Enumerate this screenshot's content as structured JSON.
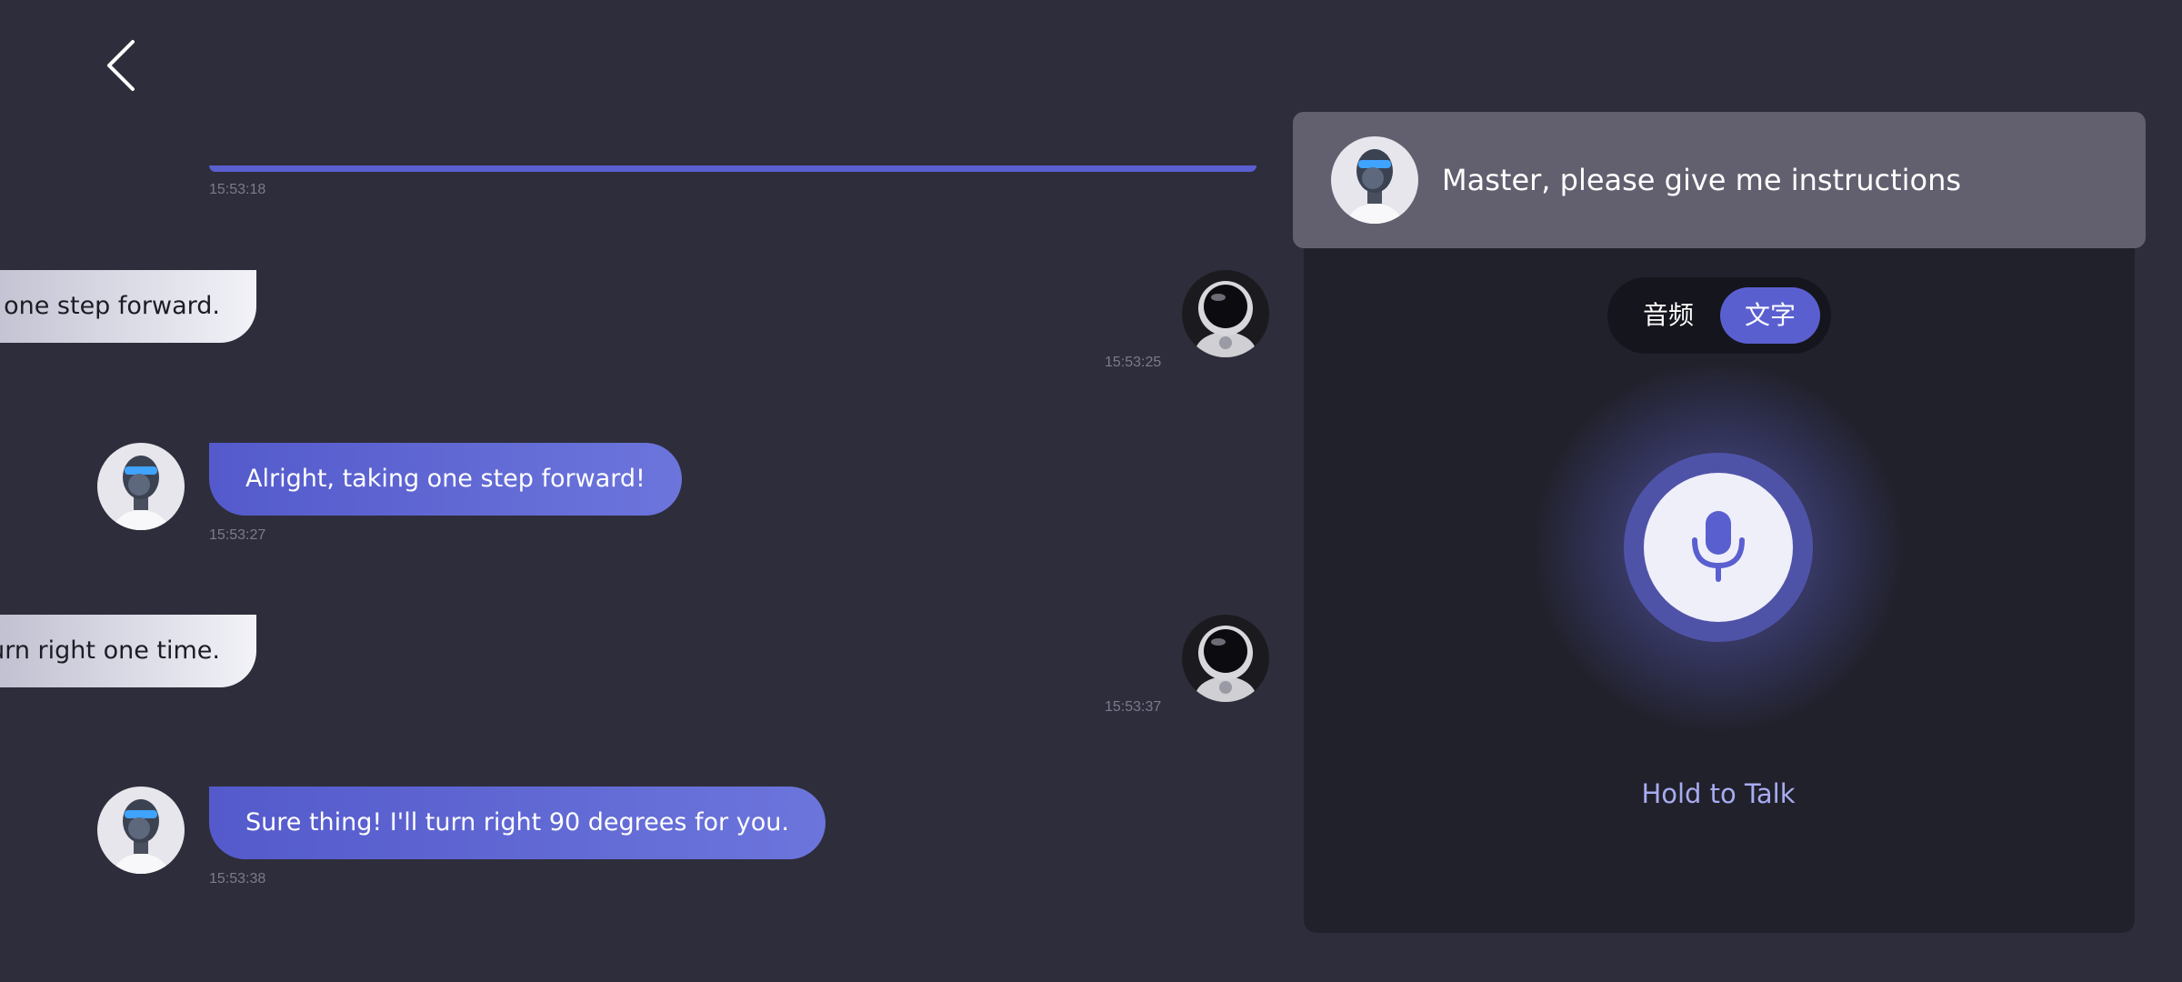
{
  "header": {
    "back_icon": "chevron-left-icon"
  },
  "messages": [
    {
      "role": "bot",
      "text": "",
      "time": "15:53:18",
      "partial": true
    },
    {
      "role": "user",
      "text": "Go one step forward.",
      "time": "15:53:25"
    },
    {
      "role": "bot",
      "text": "Alright, taking one step forward!",
      "time": "15:53:27"
    },
    {
      "role": "user",
      "text": "Turn right one time.",
      "time": "15:53:37"
    },
    {
      "role": "bot",
      "text": "Sure thing! I'll turn right 90 degrees for you.",
      "time": "15:53:38"
    }
  ],
  "panel": {
    "prompt": "Master, please give me instructions",
    "mode_toggle": {
      "options": [
        "音频",
        "文字"
      ],
      "selected": "文字"
    },
    "mic_icon": "microphone-icon",
    "hold_label": "Hold to Talk"
  },
  "colors": {
    "background": "#2e2d3b",
    "accent": "#5a5fd0",
    "panel": "#21212b",
    "prompt_card": "#62606f",
    "hold_label": "#a7acf2"
  }
}
